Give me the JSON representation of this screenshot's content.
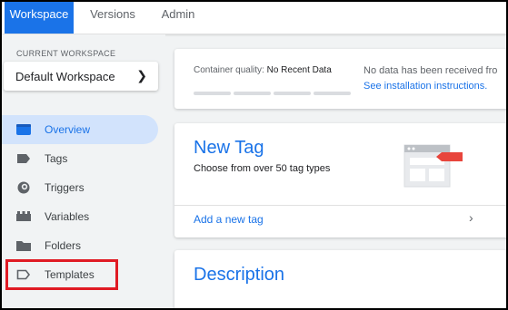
{
  "tabs": [
    {
      "label": "Workspace",
      "active": true
    },
    {
      "label": "Versions",
      "active": false
    },
    {
      "label": "Admin",
      "active": false
    }
  ],
  "sidebar": {
    "current_workspace_label": "CURRENT WORKSPACE",
    "workspace_name": "Default Workspace",
    "items": [
      {
        "label": "Overview",
        "icon": "overview-icon",
        "active": true
      },
      {
        "label": "Tags",
        "icon": "tag-icon",
        "active": false
      },
      {
        "label": "Triggers",
        "icon": "trigger-icon",
        "active": false
      },
      {
        "label": "Variables",
        "icon": "variables-icon",
        "active": false
      },
      {
        "label": "Folders",
        "icon": "folder-icon",
        "active": false
      },
      {
        "label": "Templates",
        "icon": "template-icon",
        "active": false
      }
    ]
  },
  "quality": {
    "label": "Container quality:",
    "value": "No Recent Data",
    "no_data_text": "No data has been received fro",
    "link": "See installation instructions."
  },
  "new_tag": {
    "title": "New Tag",
    "subtitle": "Choose from over 50 tag types",
    "add_link": "Add a new tag"
  },
  "description": {
    "title": "Description"
  },
  "colors": {
    "accent": "#1a73e8",
    "active_nav_bg": "#d2e3fc",
    "highlight": "#e01b24",
    "illustration_red": "#e8453c"
  }
}
